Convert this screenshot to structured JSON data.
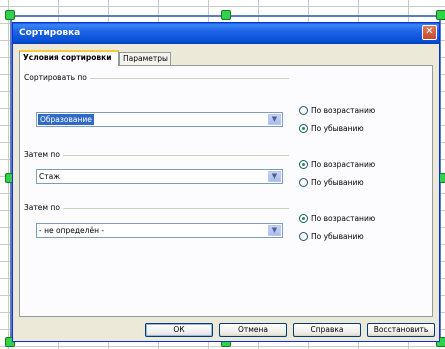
{
  "window": {
    "title": "Сортировка"
  },
  "tabs": [
    {
      "label": "Условия сортировки",
      "active": true
    },
    {
      "label": "Параметры",
      "active": false
    }
  ],
  "sort_keys": [
    {
      "group_label": "Сортировать по",
      "value": "Образование",
      "selected": true,
      "ascending_label": "По возрастанию",
      "descending_label": "По убыванию",
      "order": "descending"
    },
    {
      "group_label": "Затем по",
      "value": "Стаж",
      "selected": false,
      "ascending_label": "По возрастанию",
      "descending_label": "По убыванию",
      "order": "ascending"
    },
    {
      "group_label": "Затем по",
      "value": "- не определён -",
      "selected": false,
      "ascending_label": "По возрастанию",
      "descending_label": "По убыванию",
      "order": "ascending"
    }
  ],
  "buttons": {
    "ok": "ОК",
    "cancel": "Отмена",
    "help": "Справка",
    "reset": "Восстановить"
  },
  "icons": {
    "close": "close-icon",
    "dropdown": "chevron-down-icon"
  },
  "colors": {
    "title_bar": "#0a5ae6",
    "selection": "#316ac5",
    "handle": "#2ed34a"
  }
}
